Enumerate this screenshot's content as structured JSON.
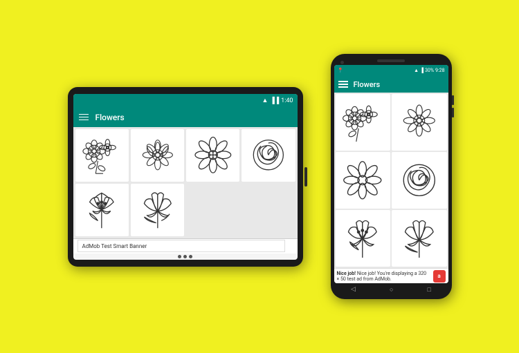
{
  "background": "#f0f020",
  "tablet": {
    "status_bar": {
      "wifi_icon": "wifi",
      "signal_icon": "signal",
      "battery_icon": "battery",
      "time": "1:40"
    },
    "toolbar": {
      "menu_icon": "hamburger",
      "title": "Flowers"
    },
    "flowers": [
      {
        "id": 1,
        "label": "flower-cluster"
      },
      {
        "id": 2,
        "label": "flower-daisy"
      },
      {
        "id": 3,
        "label": "flower-6petal"
      },
      {
        "id": 4,
        "label": "flower-rose"
      },
      {
        "id": 5,
        "label": "flower-lily1"
      },
      {
        "id": 6,
        "label": "flower-lily2"
      }
    ],
    "ad_banner": {
      "text": "AdMob Test Smart Banner",
      "arrow": "❯"
    },
    "nav_dots": 3
  },
  "phone": {
    "status_bar": {
      "left_icon": "location-pin",
      "icons": "wifi signal battery",
      "battery_percent": "30%",
      "time": "9:28"
    },
    "toolbar": {
      "menu_icon": "hamburger",
      "title": "Flowers"
    },
    "flowers": [
      {
        "id": 1,
        "label": "flower-cluster"
      },
      {
        "id": 2,
        "label": "flower-daisy"
      },
      {
        "id": 3,
        "label": "flower-6petal"
      },
      {
        "id": 4,
        "label": "flower-rose"
      },
      {
        "id": 5,
        "label": "flower-lily1"
      },
      {
        "id": 6,
        "label": "flower-lily2"
      }
    ],
    "ad_banner": {
      "text": "Nice job! You're displaying a 320 × 50 test ad from AdMob.",
      "admob_label": "a"
    },
    "nav_icons": {
      "back": "◁",
      "home": "○",
      "recent": "□"
    }
  }
}
